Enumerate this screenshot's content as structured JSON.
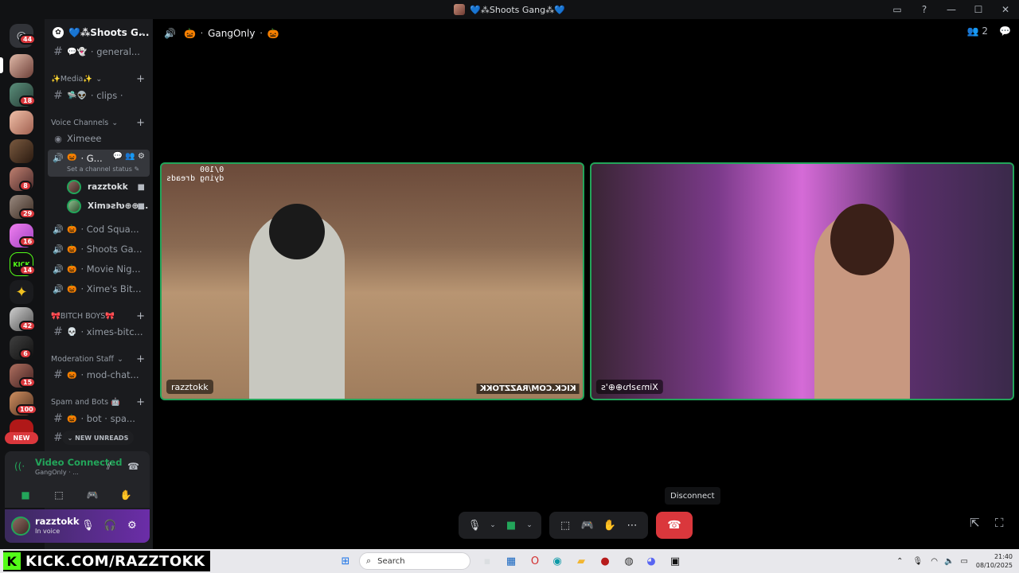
{
  "window": {
    "title": "💙⁂Shoots Gang⁂💙"
  },
  "rail": {
    "badges": [
      "44",
      "18",
      "8",
      "29",
      "16",
      "14",
      "42",
      "6",
      "15",
      "100"
    ],
    "new_label": "NEW"
  },
  "guild": {
    "name": "💙⁂Shoots G..."
  },
  "channels": {
    "general": "· general...",
    "cat_media": "✨Media✨",
    "clips": "· clips ·",
    "cat_voice": "Voice Channels",
    "ximeee": "Ximeee",
    "active_voice": "· G...",
    "status_line": "Set a channel status ✎",
    "member1": "razztokk",
    "member2": "Xim϶ƨƕ⊕⊕...",
    "cod": "· Cod Squa...",
    "shoots": "· Shoots Ga...",
    "movie": "· Movie Nig...",
    "ximes_bit": "· Xime's Bit...",
    "cat_bitch": "🎀BITCH BOYS🎀",
    "ximes_bitc": "· ximes-bitc...",
    "cat_mod": "Moderation Staff",
    "mod_chat": "· mod-chat...",
    "cat_spam": "Spam and Bots 🤖",
    "bot_spa": "· bot · spa...",
    "new_unreads": "⌄ NEW UNREADS"
  },
  "voice_panel": {
    "title": "Video Connected",
    "subtitle": "GangOnly · ..."
  },
  "user_panel": {
    "name": "razztokk",
    "status": "In voice"
  },
  "header": {
    "channel": "GangOnly",
    "participant_count": "2"
  },
  "tiles": {
    "left_name": "razztokk",
    "left_overlay_line1": "0/100",
    "left_overlay_line2": "dying dreads",
    "left_watermark": "KICK.COM/RAZZTOKK",
    "right_name": "Xim϶ƨƕ⊕⊕'s"
  },
  "controls": {
    "tooltip": "Disconnect"
  },
  "taskbar": {
    "kick_banner": "KICK.COM/RAZZTOKK",
    "search_placeholder": "Search",
    "time": "21:40",
    "date": "08/10/2025"
  },
  "colors": {
    "accent_green": "#23a55a",
    "danger_red": "#da373c",
    "kick_green": "#53fc18"
  }
}
